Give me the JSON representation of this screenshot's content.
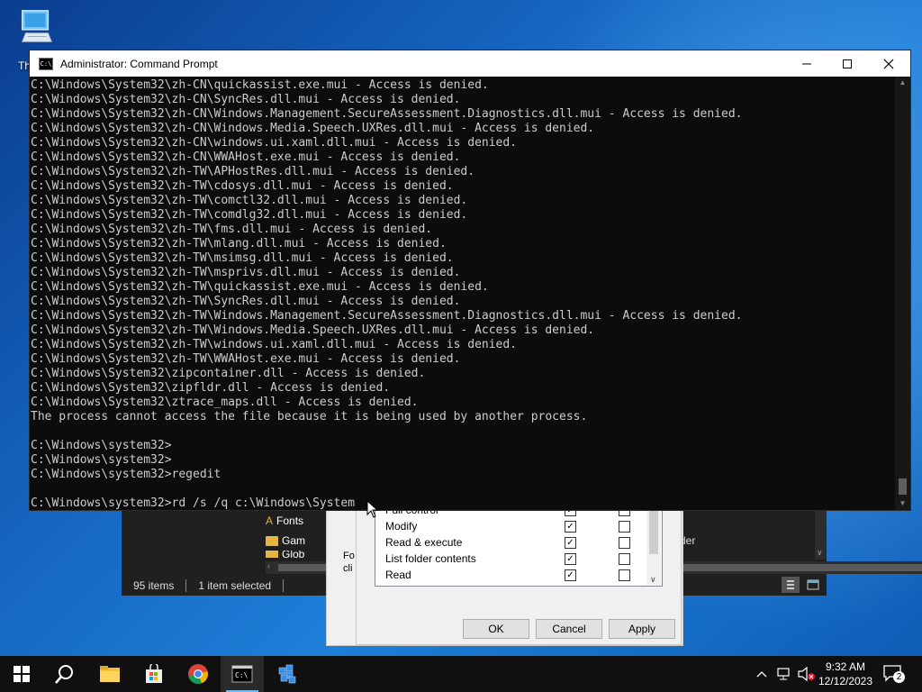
{
  "desktop": {
    "icon_label": "Th"
  },
  "cmd": {
    "title": "Administrator: Command Prompt",
    "icon_text": "C:\\",
    "lines": [
      "C:\\Windows\\System32\\zh-CN\\quickassist.exe.mui - Access is denied.",
      "C:\\Windows\\System32\\zh-CN\\SyncRes.dll.mui - Access is denied.",
      "C:\\Windows\\System32\\zh-CN\\Windows.Management.SecureAssessment.Diagnostics.dll.mui - Access is denied.",
      "C:\\Windows\\System32\\zh-CN\\Windows.Media.Speech.UXRes.dll.mui - Access is denied.",
      "C:\\Windows\\System32\\zh-CN\\windows.ui.xaml.dll.mui - Access is denied.",
      "C:\\Windows\\System32\\zh-CN\\WWAHost.exe.mui - Access is denied.",
      "C:\\Windows\\System32\\zh-TW\\APHostRes.dll.mui - Access is denied.",
      "C:\\Windows\\System32\\zh-TW\\cdosys.dll.mui - Access is denied.",
      "C:\\Windows\\System32\\zh-TW\\comctl32.dll.mui - Access is denied.",
      "C:\\Windows\\System32\\zh-TW\\comdlg32.dll.mui - Access is denied.",
      "C:\\Windows\\System32\\zh-TW\\fms.dll.mui - Access is denied.",
      "C:\\Windows\\System32\\zh-TW\\mlang.dll.mui - Access is denied.",
      "C:\\Windows\\System32\\zh-TW\\msimsg.dll.mui - Access is denied.",
      "C:\\Windows\\System32\\zh-TW\\msprivs.dll.mui - Access is denied.",
      "C:\\Windows\\System32\\zh-TW\\quickassist.exe.mui - Access is denied.",
      "C:\\Windows\\System32\\zh-TW\\SyncRes.dll.mui - Access is denied.",
      "C:\\Windows\\System32\\zh-TW\\Windows.Management.SecureAssessment.Diagnostics.dll.mui - Access is denied.",
      "C:\\Windows\\System32\\zh-TW\\Windows.Media.Speech.UXRes.dll.mui - Access is denied.",
      "C:\\Windows\\System32\\zh-TW\\windows.ui.xaml.dll.mui - Access is denied.",
      "C:\\Windows\\System32\\zh-TW\\WWAHost.exe.mui - Access is denied.",
      "C:\\Windows\\System32\\zipcontainer.dll - Access is denied.",
      "C:\\Windows\\System32\\zipfldr.dll - Access is denied.",
      "C:\\Windows\\System32\\ztrace_maps.dll - Access is denied.",
      "The process cannot access the file because it is being used by another process.",
      "",
      "C:\\Windows\\system32>",
      "C:\\Windows\\system32>",
      "C:\\Windows\\system32>regedit",
      "",
      "C:\\Windows\\system32>rd /s /q c:\\Windows\\System"
    ]
  },
  "explorer": {
    "nav_items": [
      "Fonts",
      "Gam",
      "Glob"
    ],
    "right_text": "der",
    "status_items": "95 items",
    "status_selected": "1 item selected"
  },
  "properties": {
    "side_text_1": "Fo",
    "side_text_2": "cli",
    "permissions": [
      {
        "name": "Full control",
        "allow": true,
        "deny": false
      },
      {
        "name": "Modify",
        "allow": true,
        "deny": false
      },
      {
        "name": "Read & execute",
        "allow": true,
        "deny": false
      },
      {
        "name": "List folder contents",
        "allow": true,
        "deny": false
      },
      {
        "name": "Read",
        "allow": true,
        "deny": false
      }
    ],
    "ok_label": "OK",
    "cancel_label": "Cancel",
    "apply_label": "Apply"
  },
  "taskbar": {
    "time": "9:32 AM",
    "date": "12/12/2023",
    "notification_count": "2"
  },
  "colors": {
    "console_bg": "#0c0c0c",
    "console_fg": "#cccccc",
    "taskbar_bg": "#101010",
    "accent": "#76b9ed"
  }
}
